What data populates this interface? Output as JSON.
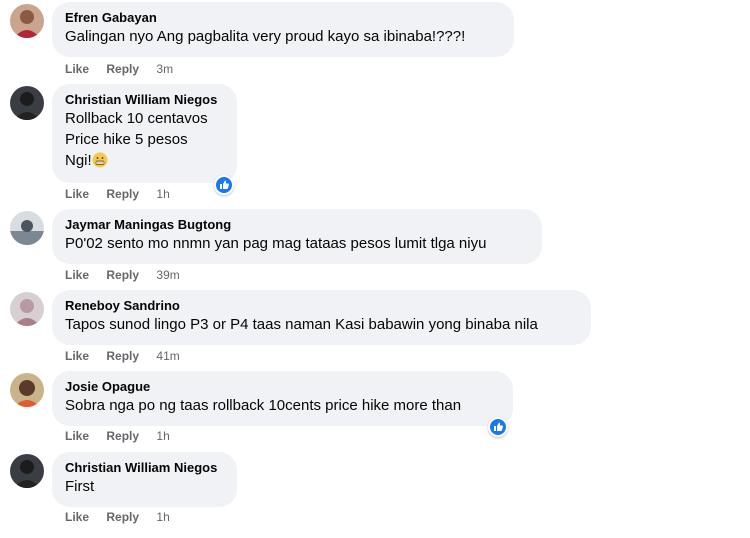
{
  "actions": {
    "like": "Like",
    "reply": "Reply"
  },
  "comments": [
    {
      "author": "Efren Gabayan",
      "lines": [
        "Galingan nyo Ang pagbalita very proud kayo sa ibinaba!???!"
      ],
      "time": "3m",
      "avatar_icon": "person-photo-avatar"
    },
    {
      "author": "Christian William Niegos",
      "lines": [
        "Rollback 10 centavos",
        "Price hike 5 pesos",
        "Ngi!"
      ],
      "emoji": "grimacing-face-emoji",
      "time": "1h",
      "reaction_icon": "like-reaction-icon"
    },
    {
      "author": "Jaymar Maningas Bugtong",
      "lines": [
        "P0'02 sento mo nnmn yan pag mag tataas pesos lumit tlga niyu"
      ],
      "time": "39m"
    },
    {
      "author": "Reneboy Sandrino",
      "lines": [
        "Tapos sunod lingo P3 or P4 taas naman Kasi babawin yong binaba nila"
      ],
      "time": "41m"
    },
    {
      "author": "Josie Opague",
      "lines": [
        "Sobra nga po ng taas rollback 10cents price hike more than"
      ],
      "time": "1h",
      "reaction_icon": "like-reaction-icon"
    },
    {
      "author": "Christian William Niegos",
      "lines": [
        "First"
      ],
      "time": "1h"
    }
  ],
  "colors": {
    "bubble": "#f0f2f5",
    "meta": "#65676b",
    "like_blue": "#1877f2"
  }
}
